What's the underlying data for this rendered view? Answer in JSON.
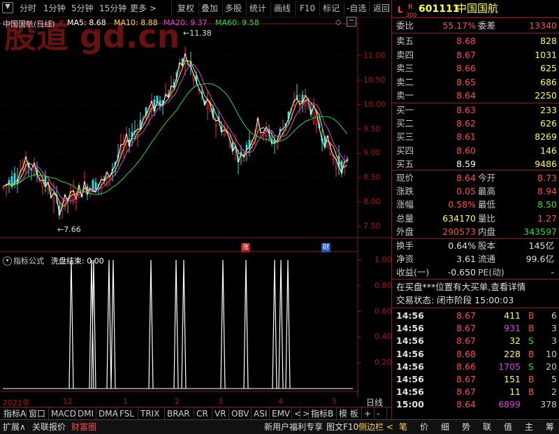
{
  "toolbar": {
    "period_tabs": [
      "分时",
      "1分钟",
      "5分钟",
      "15分钟",
      "更多 >"
    ],
    "actions": [
      "复权",
      "叠加",
      "多股",
      "统计",
      "画线",
      "F10",
      "标记",
      "-自选",
      "返回"
    ]
  },
  "chart": {
    "title": "中国国航(日线)",
    "ma_legend": [
      {
        "label": "MA5: 8.68",
        "color": "#ffffff"
      },
      {
        "label": "MA10: 8.88",
        "color": "#f0e040"
      },
      {
        "label": "MA20: 9.37",
        "color": "#e040e0"
      },
      {
        "label": "MA60: 9.58",
        "color": "#2ddc2d"
      }
    ],
    "watermark": "股道 gd.cn",
    "price_ticks": [
      "11.00",
      "10.50",
      "10.00",
      "9.50",
      "9.00",
      "8.50",
      "8.00",
      "7.50"
    ],
    "high_marker": "11.38",
    "low_marker": "7.66",
    "event_tags": [
      "涨",
      "财"
    ],
    "indicator_title": "指标公式",
    "indicator_value": "洗盘结束: 0.00",
    "indicator_ticks": [
      "1.00",
      "0.80",
      "0.60",
      "0.40",
      "0.20"
    ],
    "date_labels": [
      "2021年",
      "12",
      "1",
      "2",
      "3",
      "4",
      "5"
    ],
    "period_label": "日线"
  },
  "chart_data": {
    "type": "line",
    "title": "中国国航(日线)",
    "series": [
      {
        "name": "MA5",
        "value": 8.68
      },
      {
        "name": "MA10",
        "value": 8.88
      },
      {
        "name": "MA20",
        "value": 9.37
      },
      {
        "name": "MA60",
        "value": 9.58
      }
    ],
    "ylim": [
      7.3,
      11.6
    ],
    "high": 11.38,
    "low": 7.66,
    "indicator": {
      "name": "洗盘结束",
      "value": 0.0,
      "ylim": [
        0,
        1
      ],
      "signal_bars": [
        102,
        131,
        134,
        156,
        162,
        216,
        252,
        263,
        319,
        352,
        393,
        402,
        412
      ]
    }
  },
  "indicator_tabs": [
    "指标A",
    "窗口",
    "MACD",
    "DMI",
    "DMA",
    "FSL",
    "TRIX",
    "BRAR",
    "CR",
    "VR",
    "OBV",
    "ASI",
    "EMV",
    "<",
    ">",
    "指标B",
    "模 板",
    "+",
    "-"
  ],
  "panel": {
    "flag": "L",
    "flag2": "R",
    "flag_num": "300",
    "code": "601111",
    "name": "中国国航",
    "weibi_label": "委比",
    "weibi": "55.17%",
    "weicha_label": "委差",
    "weicha": "13340",
    "asks": [
      {
        "label": "卖五",
        "price": "8.68",
        "vol": "828"
      },
      {
        "label": "卖四",
        "price": "8.67",
        "vol": "1031"
      },
      {
        "label": "卖三",
        "price": "8.66",
        "vol": "625"
      },
      {
        "label": "卖二",
        "price": "8.65",
        "vol": "686"
      },
      {
        "label": "卖一",
        "price": "8.64",
        "vol": "2250"
      }
    ],
    "bids": [
      {
        "label": "买一",
        "price": "8.63",
        "vol": "233"
      },
      {
        "label": "买二",
        "price": "8.62",
        "vol": "626"
      },
      {
        "label": "买三",
        "price": "8.61",
        "vol": "8269"
      },
      {
        "label": "买四",
        "price": "8.60",
        "vol": "146"
      },
      {
        "label": "买五",
        "price": "8.59",
        "vol": "9486"
      }
    ],
    "quote_rows": [
      {
        "l1": "现价",
        "v1": "8.64",
        "c1": "red",
        "l2": "今开",
        "v2": "8.73",
        "c2": "red"
      },
      {
        "l1": "涨跌",
        "v1": "0.05",
        "c1": "red",
        "l2": "最高",
        "v2": "8.94",
        "c2": "red"
      },
      {
        "l1": "涨幅",
        "v1": "0.58%",
        "c1": "red",
        "l2": "最低",
        "v2": "8.50",
        "c2": "green"
      },
      {
        "l1": "总量",
        "v1": "634170",
        "c1": "yellow",
        "l2": "量比",
        "v2": "1.27",
        "c2": "red"
      },
      {
        "l1": "外盘",
        "v1": "290573",
        "c1": "red",
        "l2": "内盘",
        "v2": "343597",
        "c2": "green"
      }
    ],
    "fin_rows": [
      {
        "l1": "换手",
        "v1": "0.64%",
        "l2": "股本",
        "v2": "145亿"
      },
      {
        "l1": "净资",
        "v1": "3.61",
        "l2": "流通",
        "v2": "99.6亿"
      },
      {
        "l1": "收益(一)",
        "v1": "-0.650",
        "l2": "PE(动)",
        "v2": "-"
      }
    ],
    "notice": "在买盘***位置有大买单,查看详情",
    "trade_state": "交易状态: 闭市阶段 15:00:03",
    "ticks": [
      {
        "time": "14:56",
        "price": "8.67",
        "vol": "411",
        "dir": "B",
        "n": "6",
        "vc": "yellow",
        "dc": "red"
      },
      {
        "time": "14:56",
        "price": "8.67",
        "vol": "931",
        "dir": "B",
        "n": "3",
        "vc": "magenta",
        "dc": "red"
      },
      {
        "time": "14:56",
        "price": "8.67",
        "vol": "32",
        "dir": "S",
        "n": "3",
        "vc": "yellow",
        "dc": "green"
      },
      {
        "time": "14:56",
        "price": "8.68",
        "vol": "228",
        "dir": "B",
        "n": "10",
        "vc": "yellow",
        "dc": "red"
      },
      {
        "time": "14:56",
        "price": "8.66",
        "vol": "1705",
        "dir": "S",
        "n": "20",
        "vc": "magenta",
        "dc": "green"
      },
      {
        "time": "14:56",
        "price": "8.67",
        "vol": "151",
        "dir": "B",
        "n": "5",
        "vc": "yellow",
        "dc": "red"
      },
      {
        "time": "14:56",
        "price": "8.67",
        "vol": "11",
        "dir": "B",
        "n": "2",
        "vc": "yellow",
        "dc": "red"
      },
      {
        "time": "15:00",
        "price": "8.64",
        "vol": "6899",
        "dir": "",
        "n": "378",
        "vc": "magenta",
        "dc": "red"
      }
    ]
  },
  "status": {
    "left": [
      "扩展∧",
      "关联报价",
      "财富圈"
    ],
    "promo": "新用户福利专享",
    "mid": [
      "图文F10",
      "侧边栏 <"
    ],
    "right": [
      "笔",
      "价",
      "细",
      "势",
      "联",
      "值",
      "主",
      "筹"
    ]
  }
}
